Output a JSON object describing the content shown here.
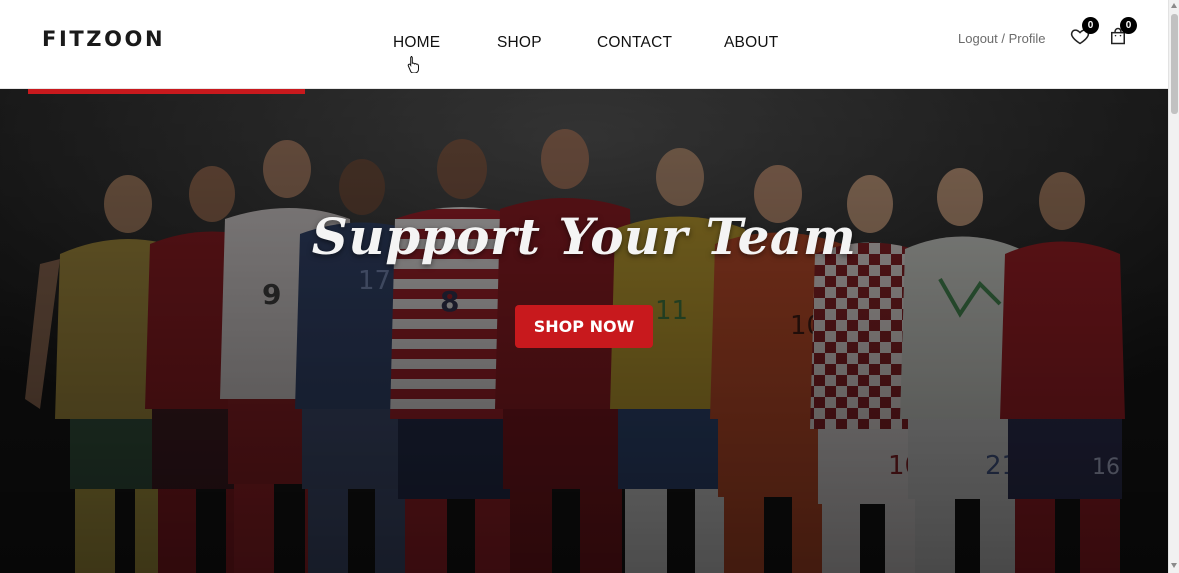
{
  "header": {
    "logo": "FITZOON",
    "nav": [
      {
        "label": "HOME"
      },
      {
        "label": "SHOP"
      },
      {
        "label": "CONTACT"
      },
      {
        "label": "ABOUT"
      }
    ],
    "account": {
      "logout": "Logout",
      "separator": " / ",
      "profile": "Profile"
    },
    "wishlist": {
      "icon": "heart-icon",
      "count": "0"
    },
    "cart": {
      "icon": "shopping-bag-icon",
      "count": "0"
    }
  },
  "hero": {
    "title": "Support Your Team",
    "cta_label": "SHOP NOW",
    "accent_color": "#c8191d"
  }
}
